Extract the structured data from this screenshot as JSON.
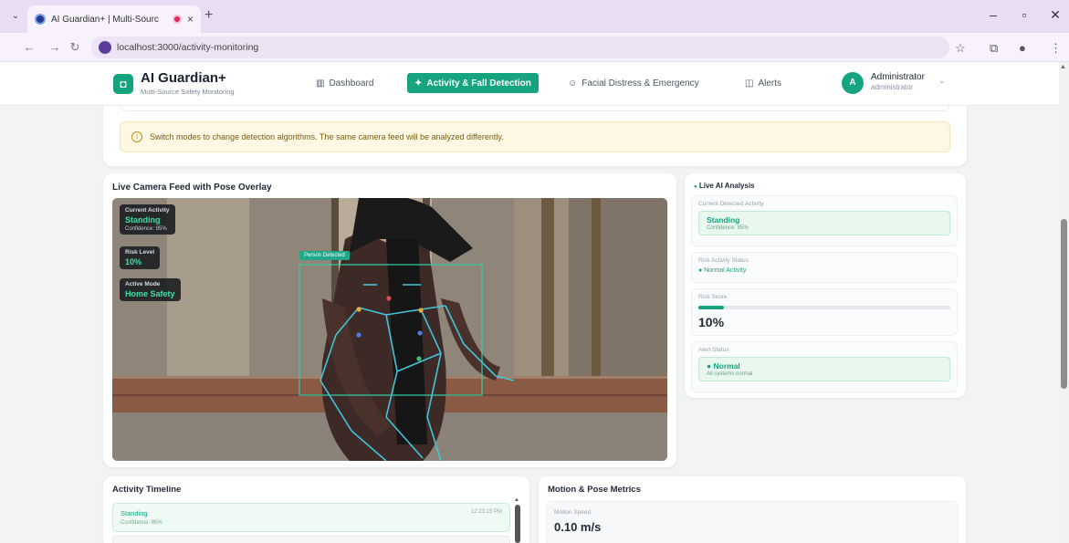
{
  "browser": {
    "tab_title": "AI Guardian+ | Multi-Sourc",
    "tab_close": "×",
    "new_tab": "+",
    "url": "localhost:3000/activity-monitoring"
  },
  "header": {
    "brand_icon": "◘",
    "brand_name": "AI Guardian+",
    "brand_sub": "Multi-Source Safety Monitoring",
    "nav": [
      {
        "label": "Dashboard",
        "glyph": "▥"
      },
      {
        "label": "Activity & Fall Detection",
        "glyph": "✦"
      },
      {
        "label": "Facial Distress & Emergency",
        "glyph": "☺"
      },
      {
        "label": "Alerts",
        "glyph": "◫"
      }
    ],
    "user_initial": "A",
    "user_name": "Administrator",
    "user_role": "administrator"
  },
  "info_banner": {
    "icon": "i",
    "text": "Switch modes to change detection algorithms. The same camera feed will be analyzed differently."
  },
  "camera": {
    "title": "Live Camera Feed with Pose Overlay",
    "person_tag": "Person Detected",
    "overlay": {
      "activity_label": "Current Activity",
      "activity_value": "Standing",
      "activity_conf": "Confidence: 85%",
      "risk_label": "Risk Level",
      "risk_value": "10%",
      "mode_label": "Active Mode",
      "mode_value": "Home Safety"
    }
  },
  "analysis": {
    "title": "Live AI Analysis",
    "current_label": "Current Detected Activity",
    "current_value": "Standing",
    "current_conf": "Confidence: 85%",
    "risk_status_label": "Risk Activity Status",
    "risk_status_value": "● Normal Activity",
    "risk_score_label": "Risk Score",
    "risk_score": "10%",
    "risk_fraction": 0.1,
    "alert_label": "Alert Status",
    "alert_value": "● Normal",
    "alert_sub": "All systems normal"
  },
  "timeline": {
    "title": "Activity Timeline",
    "items": [
      {
        "activity": "Standing",
        "confidence": "Confidence: 85%",
        "time": "12:23:15 PM"
      }
    ]
  },
  "metrics": {
    "title": "Motion & Pose Metrics",
    "speed_label": "Motion Speed",
    "speed_value": "0.10 m/s"
  },
  "colors": {
    "accent": "#16a37f",
    "pose_line": "#3fc6d8",
    "box": "#2fd1a8"
  }
}
